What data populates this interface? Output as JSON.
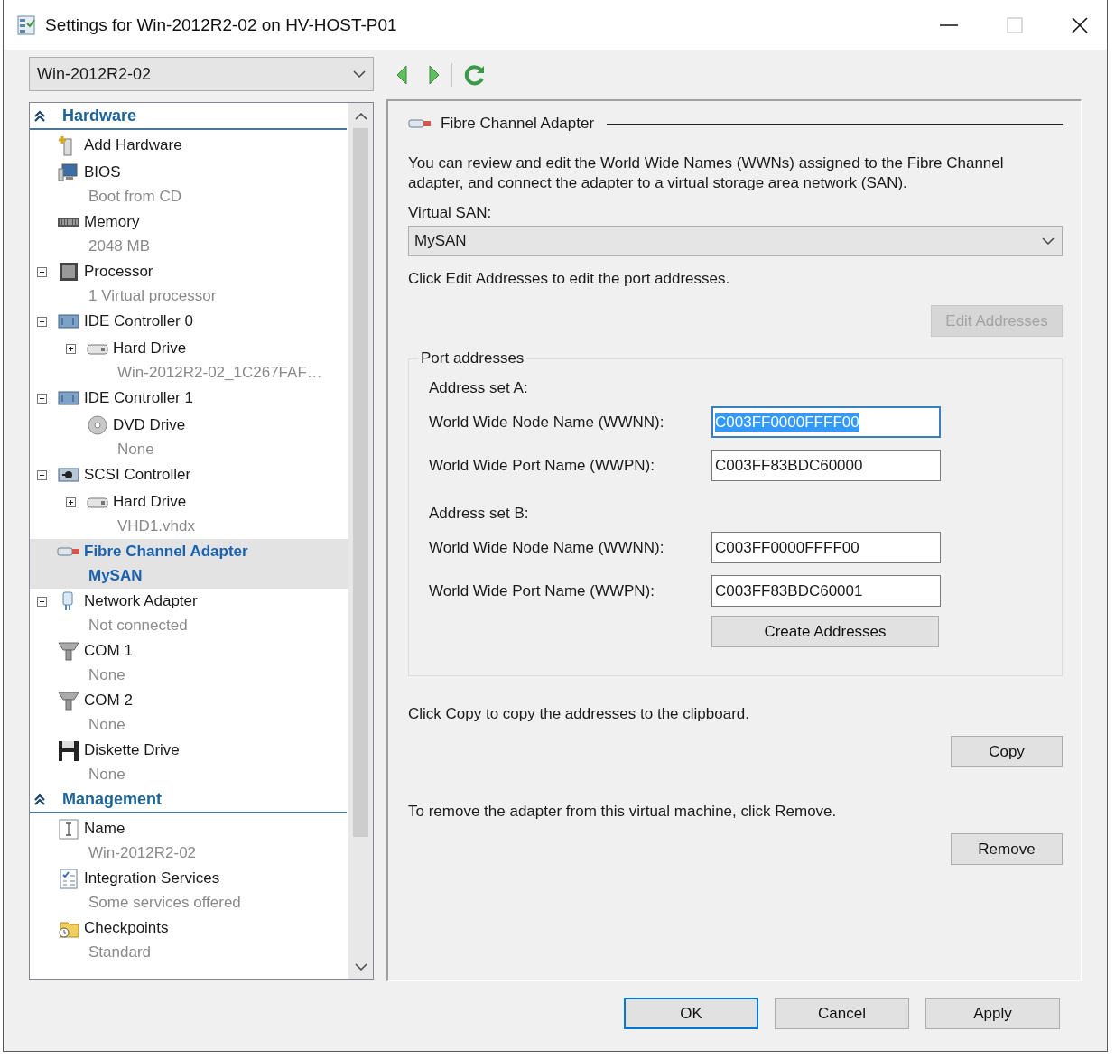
{
  "window": {
    "title": "Settings for Win-2012R2-02 on HV-HOST-P01"
  },
  "vm_selector": {
    "value": "Win-2012R2-02"
  },
  "sidebar": {
    "sections": [
      {
        "title": "Hardware",
        "expanded": true,
        "items": [
          {
            "kind": "add",
            "label": "Add Hardware",
            "selected": false
          },
          {
            "kind": "bios",
            "label": "BIOS",
            "detail": "Boot from CD",
            "selected": false
          },
          {
            "kind": "memory",
            "label": "Memory",
            "detail": "2048 MB",
            "selected": false
          },
          {
            "kind": "cpu",
            "label": "Processor",
            "detail": "1 Virtual processor",
            "expanded": false,
            "selected": false
          },
          {
            "kind": "controller",
            "label": "IDE Controller 0",
            "expanded": true,
            "selected": false,
            "children": [
              {
                "kind": "disk",
                "label": "Hard Drive",
                "detail": "Win-2012R2-02_1C267FAF…",
                "expanded": false,
                "selected": false
              }
            ]
          },
          {
            "kind": "controller",
            "label": "IDE Controller 1",
            "expanded": true,
            "selected": false,
            "children": [
              {
                "kind": "dvd",
                "label": "DVD Drive",
                "detail": "None",
                "selected": false
              }
            ]
          },
          {
            "kind": "scsi",
            "label": "SCSI Controller",
            "expanded": true,
            "selected": false,
            "children": [
              {
                "kind": "disk",
                "label": "Hard Drive",
                "detail": "VHD1.vhdx",
                "expanded": false,
                "selected": false
              }
            ]
          },
          {
            "kind": "fibre",
            "label": "Fibre Channel Adapter",
            "detail": "MySAN",
            "selected": true
          },
          {
            "kind": "network",
            "label": "Network Adapter",
            "detail": "Not connected",
            "expanded": false,
            "selected": false
          },
          {
            "kind": "com",
            "label": "COM 1",
            "detail": "None",
            "selected": false
          },
          {
            "kind": "com",
            "label": "COM 2",
            "detail": "None",
            "selected": false
          },
          {
            "kind": "floppy",
            "label": "Diskette Drive",
            "detail": "None",
            "selected": false
          }
        ]
      },
      {
        "title": "Management",
        "expanded": true,
        "items": [
          {
            "kind": "name",
            "label": "Name",
            "detail": "Win-2012R2-02",
            "selected": false
          },
          {
            "kind": "integration",
            "label": "Integration Services",
            "detail": "Some services offered",
            "selected": false
          },
          {
            "kind": "checkpoint",
            "label": "Checkpoints",
            "detail": "Standard",
            "selected": false
          }
        ]
      }
    ]
  },
  "panel": {
    "title": "Fibre Channel Adapter",
    "description": "You can review and edit the World Wide Names (WWNs) assigned to the Fibre Channel adapter, and connect the adapter to a virtual storage area network (SAN).",
    "virtual_san": {
      "label": "Virtual SAN:",
      "value": "MySAN"
    },
    "edit_hint": "Click Edit Addresses to edit the port addresses.",
    "edit_button": {
      "label": "Edit Addresses",
      "disabled": true
    },
    "port_addresses": {
      "title": "Port addresses",
      "sets": [
        {
          "title": "Address set A:",
          "fields": [
            {
              "label": "World Wide Node Name (WWNN):",
              "value": "C003FF0000FFFF00",
              "text_selected": true
            },
            {
              "label": "World Wide Port Name (WWPN):",
              "value": "C003FF83BDC60000",
              "text_selected": false
            }
          ]
        },
        {
          "title": "Address set B:",
          "fields": [
            {
              "label": "World Wide Node Name (WWNN):",
              "value": "C003FF0000FFFF00",
              "text_selected": false
            },
            {
              "label": "World Wide Port Name (WWPN):",
              "value": "C003FF83BDC60001",
              "text_selected": false
            }
          ]
        }
      ],
      "create_button": {
        "label": "Create Addresses",
        "disabled": false
      }
    },
    "copy_hint": "Click Copy to copy the addresses to the clipboard.",
    "copy_button": {
      "label": "Copy",
      "disabled": false
    },
    "remove_hint": "To remove the adapter from this virtual machine, click Remove.",
    "remove_button": {
      "label": "Remove",
      "disabled": false
    }
  },
  "footer": {
    "buttons": [
      {
        "label": "OK",
        "default": true
      },
      {
        "label": "Cancel",
        "default": false
      },
      {
        "label": "Apply",
        "default": false
      }
    ]
  }
}
